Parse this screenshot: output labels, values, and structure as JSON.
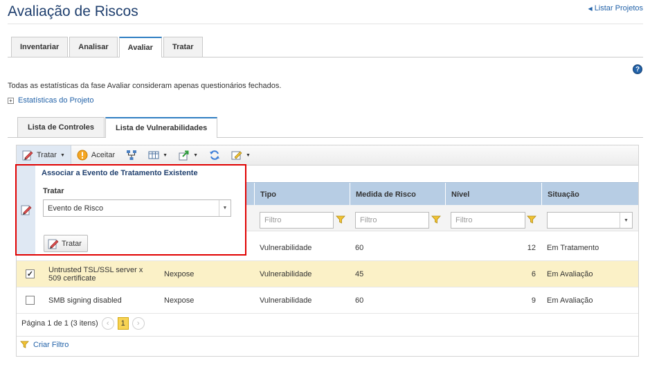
{
  "header": {
    "title": "Avaliação de Riscos",
    "list_projects": "Listar Projetos"
  },
  "tabs": [
    {
      "label": "Inventariar"
    },
    {
      "label": "Analisar"
    },
    {
      "label": "Avaliar",
      "active": true
    },
    {
      "label": "Tratar"
    }
  ],
  "help": {
    "glyph": "?"
  },
  "info_text": "Todas as estatísticas da fase Avaliar consideram apenas questionários fechados.",
  "stats_link": "Estatísticas do Projeto",
  "subtabs": [
    {
      "label": "Lista de Controles"
    },
    {
      "label": "Lista de Vulnerabilidades",
      "active": true
    }
  ],
  "toolbar": {
    "tratar": "Tratar",
    "aceitar": "Aceitar"
  },
  "grid": {
    "columns": [
      "Tipo",
      "Medida de Risco",
      "Nível",
      "Situação"
    ],
    "filter_placeholder": "Filtro",
    "rows": [
      {
        "checked": false,
        "name": "",
        "source": "",
        "tipo": "Vulnerabilidade",
        "medida": "60",
        "nivel": "12",
        "situacao": "Em Tratamento"
      },
      {
        "checked": true,
        "name": "Untrusted TSL/SSL server x 509 certificate",
        "source": "Nexpose",
        "tipo": "Vulnerabilidade",
        "medida": "45",
        "nivel": "6",
        "situacao": "Em Avaliação"
      },
      {
        "checked": false,
        "name": "SMB signing disabled",
        "source": "Nexpose",
        "tipo": "Vulnerabilidade",
        "medida": "60",
        "nivel": "9",
        "situacao": "Em Avaliação"
      }
    ],
    "pager": {
      "text": "Página 1 de 1 (3 itens)",
      "page": "1",
      "prev": "‹",
      "next": "›"
    },
    "create_filter": "Criar Filtro"
  },
  "popup": {
    "title": "Associar a Evento de Tratamento Existente",
    "field_label": "Tratar",
    "select_value": "Evento de Risco",
    "button": "Tratar"
  },
  "colors": {
    "accent": "#2262a8",
    "header_bg": "#b7cde4",
    "selected_row": "#fbf1c7",
    "highlight_border": "#e00000"
  }
}
